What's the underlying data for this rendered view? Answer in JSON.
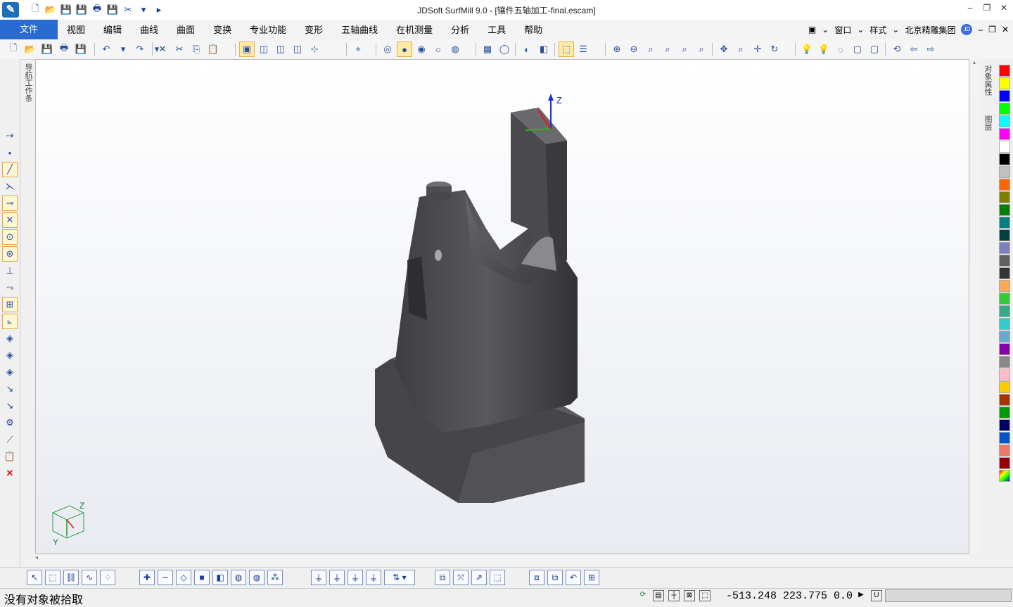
{
  "window": {
    "title": "JDSoft SurfMill 9.0 - [镶件五轴加工-final.escam]",
    "controls": [
      "–",
      "❐",
      "✕"
    ]
  },
  "menubar": {
    "file_tab": "文件",
    "items": [
      "视图",
      "编辑",
      "曲线",
      "曲面",
      "变换",
      "专业功能",
      "变形",
      "五轴曲线",
      "在机测量",
      "分析",
      "工具",
      "帮助"
    ],
    "right": {
      "window": "窗口",
      "style": "样式",
      "company": "北京精雕集团",
      "badge": "JD"
    }
  },
  "panels": {
    "left_tab": "导航工作条",
    "right_tab_1": "对象属性",
    "right_tab_2": "图层"
  },
  "viewport": {
    "triad_z_label": "Z",
    "corner_axis_labels": {
      "z": "Z",
      "y": "Y"
    }
  },
  "palette": [
    "#ff0000",
    "#ffff00",
    "#0000ff",
    "#00ff00",
    "#00ffff",
    "#ff00ff",
    "#ffffff",
    "#000000",
    "#c0c0c0",
    "#ff6600",
    "#808000",
    "#008000",
    "#008080",
    "#004040",
    "#7f7fbf",
    "#606060",
    "#333333",
    "#ffaa55",
    "#33cc33",
    "#33aa88",
    "#33cccc",
    "#66aacc",
    "#8800aa",
    "#888888",
    "#ffbbcc",
    "#ffcc00",
    "#aa3300",
    "#009900",
    "#000066",
    "#0055cc",
    "#ee7766",
    "#990000",
    "#multi"
  ],
  "status": {
    "message": "没有对象被拾取",
    "coordinates": "-513.248 223.775 0.0"
  },
  "colors": {
    "file_tab": "#2a6bd2",
    "model": "#4a4a4c",
    "accent": "#1e6fb8"
  }
}
